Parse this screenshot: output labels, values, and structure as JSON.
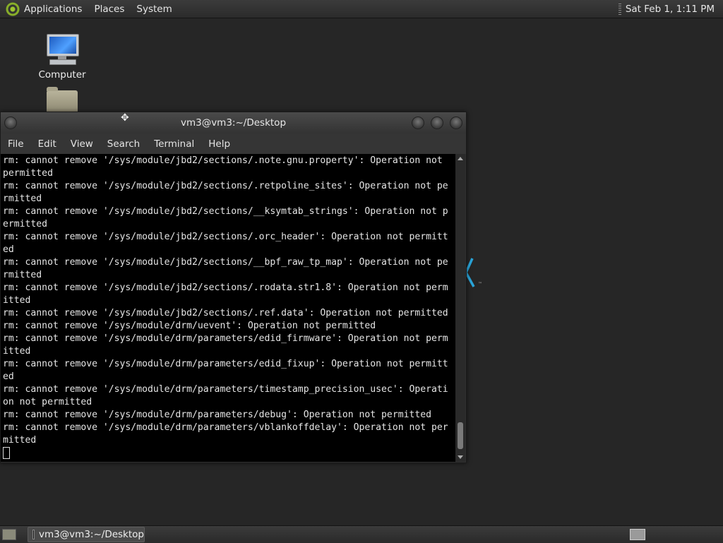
{
  "top_panel": {
    "menus": [
      "Applications",
      "Places",
      "System"
    ],
    "clock": "Sat Feb  1,  1:11 PM"
  },
  "desktop": {
    "icons": [
      {
        "label": "Computer",
        "icon": "computer-icon"
      },
      {
        "label": "",
        "icon": "folder-icon"
      }
    ]
  },
  "window": {
    "title": "vm3@vm3:~/Desktop",
    "menus": [
      "File",
      "Edit",
      "View",
      "Search",
      "Terminal",
      "Help"
    ],
    "terminal_lines": [
      "rm: cannot remove '/sys/module/jbd2/sections/.note.gnu.property': Operation not",
      "permitted",
      "rm: cannot remove '/sys/module/jbd2/sections/.retpoline_sites': Operation not pe",
      "rmitted",
      "rm: cannot remove '/sys/module/jbd2/sections/__ksymtab_strings': Operation not p",
      "ermitted",
      "rm: cannot remove '/sys/module/jbd2/sections/.orc_header': Operation not permitt",
      "ed",
      "rm: cannot remove '/sys/module/jbd2/sections/__bpf_raw_tp_map': Operation not pe",
      "rmitted",
      "rm: cannot remove '/sys/module/jbd2/sections/.rodata.str1.8': Operation not perm",
      "itted",
      "rm: cannot remove '/sys/module/jbd2/sections/.ref.data': Operation not permitted",
      "rm: cannot remove '/sys/module/drm/uevent': Operation not permitted",
      "rm: cannot remove '/sys/module/drm/parameters/edid_firmware': Operation not perm",
      "itted",
      "rm: cannot remove '/sys/module/drm/parameters/edid_fixup': Operation not permitt",
      "ed",
      "rm: cannot remove '/sys/module/drm/parameters/timestamp_precision_usec': Operati",
      "on not permitted",
      "rm: cannot remove '/sys/module/drm/parameters/debug': Operation not permitted",
      "rm: cannot remove '/sys/module/drm/parameters/vblankoffdelay': Operation not per",
      "mitted"
    ]
  },
  "taskbar": {
    "task_label": "vm3@vm3:~/Desktop"
  },
  "colors": {
    "desktop_bg": "#262626",
    "terminal_bg": "#000000",
    "terminal_fg": "#e5e5e5",
    "logo_accent": "#2aa4d8"
  }
}
